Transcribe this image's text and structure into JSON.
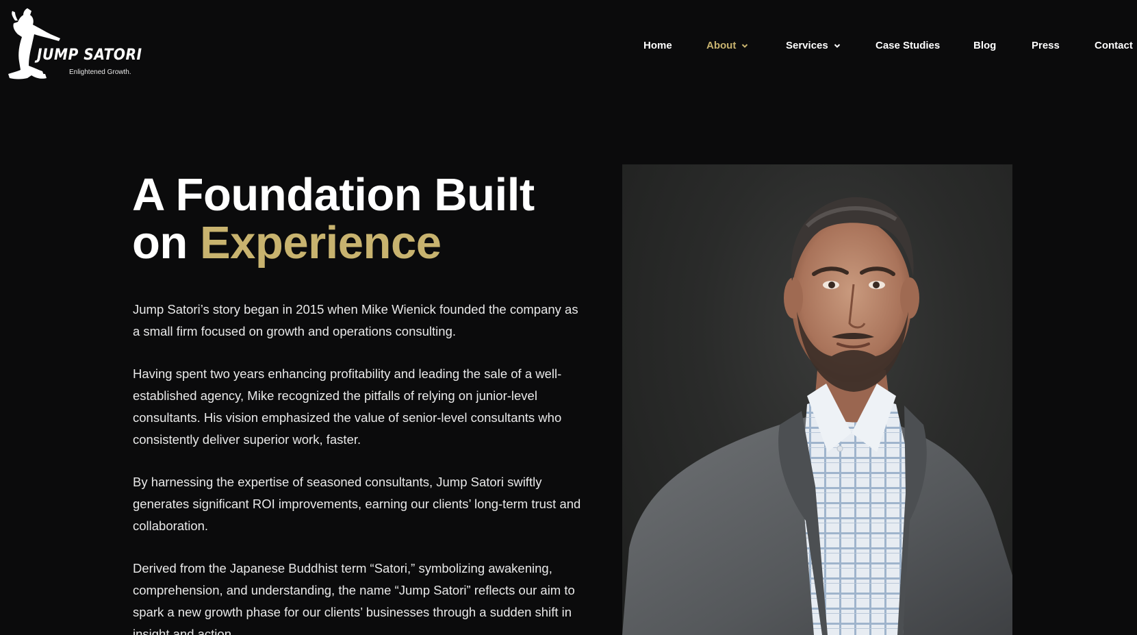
{
  "brand": {
    "name": "JUMP SATORI",
    "tagline": "Enlightened Growth."
  },
  "nav": {
    "items": [
      {
        "label": "Home",
        "active": false,
        "has_dropdown": false
      },
      {
        "label": "About",
        "active": true,
        "has_dropdown": true
      },
      {
        "label": "Services",
        "active": false,
        "has_dropdown": true
      },
      {
        "label": "Case Studies",
        "active": false,
        "has_dropdown": false
      },
      {
        "label": "Blog",
        "active": false,
        "has_dropdown": false
      },
      {
        "label": "Press",
        "active": false,
        "has_dropdown": false
      },
      {
        "label": "Contact",
        "active": false,
        "has_dropdown": false
      }
    ]
  },
  "hero": {
    "headline_line1": "A Foundation Built",
    "headline_prefix": "on ",
    "headline_accent": "Experience",
    "paragraphs": [
      "Jump Satori’s story began in 2015 when Mike Wienick founded the company as a small firm focused on growth and operations consulting.",
      "Having spent two years enhancing profitability and leading the sale of a well-established agency, Mike recognized the pitfalls of relying on junior-level consultants. His vision emphasized the value of senior-level consultants who consistently deliver superior work, faster.",
      "By harnessing the expertise of seasoned consultants, Jump Satori swiftly generates significant ROI improvements, earning our clients’ long-term trust and collaboration.",
      "Derived from the Japanese Buddhist term “Satori,” symbolizing awakening, comprehension, and understanding, the name “Jump Satori” reflects our aim to spark a new growth phase for our clients’ businesses through a sudden shift in insight and action."
    ]
  },
  "colors": {
    "background": "#0b0b0c",
    "accent_gold": "#c8b36f",
    "text": "#ffffff"
  },
  "icons": {
    "logo": "jumping-figure-icon",
    "dropdown": "chevron-down-icon"
  }
}
